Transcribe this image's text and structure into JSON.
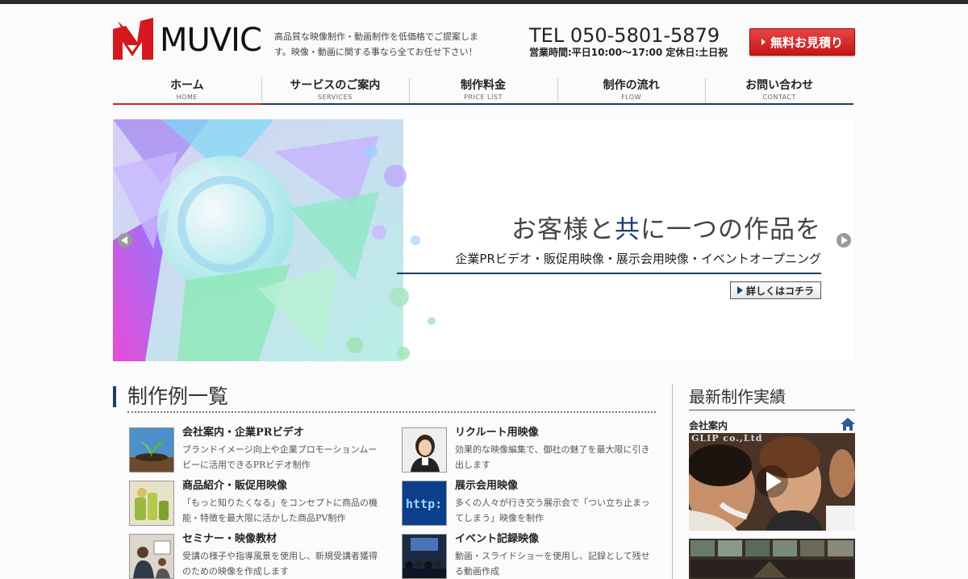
{
  "header": {
    "logo_text": "MUVIC",
    "tagline": "高品質な映像制作・動画制作を低価格でご提案します。映像・動画に関する事なら全てお任せ下さい！",
    "tel": "TEL 050-5801-5879",
    "hours": "営業時間:平日10:00～17:00 定休日:土日祝",
    "estimate_button": "無料お見積り"
  },
  "nav": {
    "items": [
      {
        "label": "ホーム",
        "sub": "HOME",
        "active": true
      },
      {
        "label": "サービスのご案内",
        "sub": "SERVICES",
        "active": false
      },
      {
        "label": "制作料金",
        "sub": "PRICE LIST",
        "active": false
      },
      {
        "label": "制作の流れ",
        "sub": "FLOW",
        "active": false
      },
      {
        "label": "お問い合わせ",
        "sub": "CONTACT",
        "active": false
      }
    ]
  },
  "hero": {
    "headline_pre": "お客様と",
    "headline_accent": "共",
    "headline_post": "に一つの作品を",
    "sub": "企業PRビデオ・販促用映像・展示会用映像・イベントオープニング",
    "more_button": "詳しくはコチラ",
    "prev_icon": "chevron-left-icon",
    "next_icon": "chevron-right-icon"
  },
  "works": {
    "title": "制作例一覧",
    "items": [
      {
        "title": "会社案内・企業PRビデオ",
        "desc": "ブランドイメージ向上や企業プロモーションムービーに活用できるPRビデオ制作"
      },
      {
        "title": "リクルート用映像",
        "desc": "効果的な映像編集で、御社の魅了を最大限に引き出します"
      },
      {
        "title": "商品紹介・販促用映像",
        "desc": "「もっと知りたくなる」をコンセプトに商品の機能・特徴を最大限に活かした商品PV制作"
      },
      {
        "title": "展示会用映像",
        "desc": "多くの人々が行き交う展示会で「つい立ち止まってしまう」映像を制作"
      },
      {
        "title": "セミナー・映像教材",
        "desc": "受講の様子や指導風景を使用し、新規受講者獲得のための映像を作成します"
      },
      {
        "title": "イベント記録映像",
        "desc": "動画・スライドショーを使用し、記録として残せる動画作成"
      }
    ]
  },
  "sidebar": {
    "title": "最新制作実績",
    "category": "会社案内",
    "video_label": "GLIP co.,Ltd"
  },
  "colors": {
    "brand_red": "#c9202a",
    "navy": "#1f3c63",
    "accent_blue": "#1d3f7a"
  }
}
